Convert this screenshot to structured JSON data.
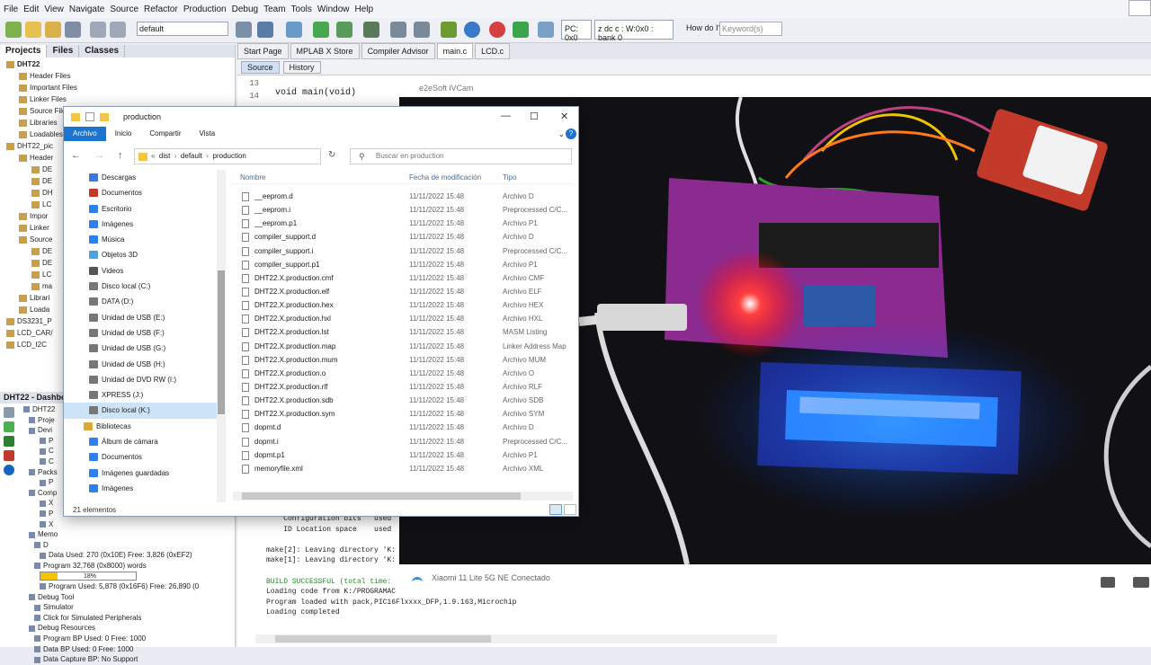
{
  "menu": [
    "File",
    "Edit",
    "View",
    "Navigate",
    "Source",
    "Refactor",
    "Production",
    "Debug",
    "Team",
    "Tools",
    "Window",
    "Help"
  ],
  "toolbar": {
    "config_select": "default",
    "pc": "PC: 0x0",
    "status": "z dc c  : W:0x0 : bank 0",
    "howdo": "How do I?",
    "keyword_placeholder": "Keyword(s)"
  },
  "projects_panel": {
    "tabs": [
      "Projects",
      "Files",
      "Classes"
    ],
    "tree": [
      {
        "label": "DHT22",
        "bold": true,
        "indent": 1
      },
      {
        "label": "Header Files",
        "indent": 3
      },
      {
        "label": "Important Files",
        "indent": 3
      },
      {
        "label": "Linker Files",
        "indent": 3
      },
      {
        "label": "Source Files",
        "indent": 3
      },
      {
        "label": "Libraries",
        "indent": 3
      },
      {
        "label": "Loadables",
        "indent": 3
      },
      {
        "label": "DHT22_pic",
        "indent": 1
      },
      {
        "label": "Header",
        "indent": 3
      },
      {
        "label": "DE",
        "indent": 5
      },
      {
        "label": "DE",
        "indent": 5
      },
      {
        "label": "DH",
        "indent": 5
      },
      {
        "label": "LC",
        "indent": 5
      },
      {
        "label": "Impor",
        "indent": 3
      },
      {
        "label": "Linker",
        "indent": 3
      },
      {
        "label": "Source",
        "indent": 3
      },
      {
        "label": "DE",
        "indent": 5
      },
      {
        "label": "DE",
        "indent": 5
      },
      {
        "label": "LC",
        "indent": 5
      },
      {
        "label": "ma",
        "indent": 5
      },
      {
        "label": "Librari",
        "indent": 3
      },
      {
        "label": "Loada",
        "indent": 3
      },
      {
        "label": "DS3231_P",
        "indent": 1
      },
      {
        "label": "LCD_CAR/",
        "indent": 1
      },
      {
        "label": "LCD_I2C",
        "indent": 1
      }
    ]
  },
  "dashboard": {
    "title": "DHT22 - Dashbo",
    "items": [
      {
        "label": "DHT22",
        "indent": 1
      },
      {
        "label": "Proje",
        "indent": 2
      },
      {
        "label": "Devi",
        "indent": 2
      },
      {
        "label": "P",
        "indent": 4
      },
      {
        "label": "C",
        "indent": 4
      },
      {
        "label": "C",
        "indent": 4
      },
      {
        "label": "Packs",
        "indent": 2
      },
      {
        "label": "P",
        "indent": 4
      },
      {
        "label": "Comp",
        "indent": 2
      },
      {
        "label": "X",
        "indent": 4
      },
      {
        "label": "P",
        "indent": 4
      },
      {
        "label": "X",
        "indent": 4
      },
      {
        "label": "Memo",
        "indent": 2
      },
      {
        "label": "D",
        "indent": 3
      },
      {
        "label": "Data Used: 270 (0x10E) Free: 3,826 (0xEF2)",
        "indent": 4
      },
      {
        "label": "Program 32,768 (0x8000) words",
        "indent": 3
      },
      {
        "label": "18%",
        "indent": 4,
        "bar": 0.18
      },
      {
        "label": "Program Used: 5,878 (0x16F6) Free: 26,890 (0",
        "indent": 4
      },
      {
        "label": "Debug Tool",
        "indent": 2
      },
      {
        "label": "Simulator",
        "indent": 3
      },
      {
        "label": "Click for Simulated Peripherals",
        "indent": 3
      },
      {
        "label": "Debug Resources",
        "indent": 2
      },
      {
        "label": "Program BP Used: 0  Free: 1000",
        "indent": 3
      },
      {
        "label": "Data BP Used: 0  Free: 1000",
        "indent": 3
      },
      {
        "label": "Data Capture BP: No Support",
        "indent": 3
      }
    ]
  },
  "editor": {
    "tabs": [
      "Start Page",
      "MPLAB X Store",
      "Compiler Advisor",
      "main.c",
      "LCD.c"
    ],
    "active_tab": "main.c",
    "subtabs": [
      "Source",
      "History"
    ],
    "lines": [
      "13",
      "14"
    ],
    "code": "void main(void)",
    "output": [
      "    Configuration bits   used",
      "    ID Location space    used",
      "",
      "make[2]: Leaving directory 'K:",
      "make[1]: Leaving directory 'K:",
      "",
      "BUILD SUCCESSFUL (total time:",
      "Loading code from K:/PROGRAMAC",
      "Program loaded with pack,PIC16Flxxxx_DFP,1.9.163,Microchip",
      "Loading completed"
    ]
  },
  "camera": {
    "title": "e2eSoft iVCam",
    "connection": "Xiaomi 11 Lite 5G NE Conectado"
  },
  "explorer": {
    "title": "production",
    "ribbon": [
      "Archivo",
      "Inicio",
      "Compartir",
      "Vista"
    ],
    "breadcrumb": [
      "dist",
      "default",
      "production"
    ],
    "search_placeholder": "Buscar en production",
    "nav": [
      {
        "label": "Descargas",
        "color": "#3a7bd5"
      },
      {
        "label": "Documentos",
        "color": "#c0392b"
      },
      {
        "label": "Escritorio",
        "color": "#2f80ed"
      },
      {
        "label": "Imágenes",
        "color": "#2f80ed"
      },
      {
        "label": "Música",
        "color": "#2f80ed"
      },
      {
        "label": "Objetos 3D",
        "color": "#4aa3df"
      },
      {
        "label": "Videos",
        "color": "#555"
      },
      {
        "label": "Disco local (C:)",
        "color": "#777"
      },
      {
        "label": "DATA (D:)",
        "color": "#777"
      },
      {
        "label": "Unidad de USB (E:)",
        "color": "#777"
      },
      {
        "label": "Unidad de USB (F:)",
        "color": "#777"
      },
      {
        "label": "Unidad de USB (G:)",
        "color": "#777"
      },
      {
        "label": "Unidad de USB (H:)",
        "color": "#777"
      },
      {
        "label": "Unidad de DVD RW (I:)",
        "color": "#777"
      },
      {
        "label": "XPRESS (J:)",
        "color": "#777"
      },
      {
        "label": "Disco local (K:)",
        "color": "#777",
        "selected": true
      },
      {
        "label": "Bibliotecas",
        "color": "#d9a93a",
        "indent": -6
      },
      {
        "label": "Álbum de cámara",
        "color": "#2f80ed"
      },
      {
        "label": "Documentos",
        "color": "#2f80ed"
      },
      {
        "label": "Imágenes guardadas",
        "color": "#2f80ed"
      },
      {
        "label": "Imágenes",
        "color": "#2f80ed"
      }
    ],
    "columns": [
      "Nombre",
      "Fecha de modificación",
      "Tipo"
    ],
    "files": [
      {
        "name": "__eeprom.d",
        "date": "11/11/2022 15:48",
        "type": "Archivo D"
      },
      {
        "name": "__eeprom.i",
        "date": "11/11/2022 15:48",
        "type": "Preprocessed C/C..."
      },
      {
        "name": "__eeprom.p1",
        "date": "11/11/2022 15:48",
        "type": "Archivo P1"
      },
      {
        "name": "compiler_support.d",
        "date": "11/11/2022 15:48",
        "type": "Archivo D"
      },
      {
        "name": "compiler_support.i",
        "date": "11/11/2022 15:48",
        "type": "Preprocessed C/C..."
      },
      {
        "name": "compiler_support.p1",
        "date": "11/11/2022 15:48",
        "type": "Archivo P1"
      },
      {
        "name": "DHT22.X.production.cmf",
        "date": "11/11/2022 15:48",
        "type": "Archivo CMF"
      },
      {
        "name": "DHT22.X.production.elf",
        "date": "11/11/2022 15:48",
        "type": "Archivo ELF"
      },
      {
        "name": "DHT22.X.production.hex",
        "date": "11/11/2022 15:48",
        "type": "Archivo HEX"
      },
      {
        "name": "DHT22.X.production.hxl",
        "date": "11/11/2022 15:48",
        "type": "Archivo HXL"
      },
      {
        "name": "DHT22.X.production.lst",
        "date": "11/11/2022 15:48",
        "type": "MASM Listing"
      },
      {
        "name": "DHT22.X.production.map",
        "date": "11/11/2022 15:48",
        "type": "Linker Address Map"
      },
      {
        "name": "DHT22.X.production.mum",
        "date": "11/11/2022 15:48",
        "type": "Archivo MUM"
      },
      {
        "name": "DHT22.X.production.o",
        "date": "11/11/2022 15:48",
        "type": "Archivo O"
      },
      {
        "name": "DHT22.X.production.rlf",
        "date": "11/11/2022 15:48",
        "type": "Archivo RLF"
      },
      {
        "name": "DHT22.X.production.sdb",
        "date": "11/11/2022 15:48",
        "type": "Archivo SDB"
      },
      {
        "name": "DHT22.X.production.sym",
        "date": "11/11/2022 15:48",
        "type": "Archivo SYM"
      },
      {
        "name": "doprnt.d",
        "date": "11/11/2022 15:48",
        "type": "Archivo D"
      },
      {
        "name": "doprnt.i",
        "date": "11/11/2022 15:48",
        "type": "Preprocessed C/C..."
      },
      {
        "name": "doprnt.p1",
        "date": "11/11/2022 15:48",
        "type": "Archivo P1"
      },
      {
        "name": "memoryfile.xml",
        "date": "11/11/2022 15:48",
        "type": "Archivo XML"
      }
    ],
    "status": "21 elementos"
  }
}
